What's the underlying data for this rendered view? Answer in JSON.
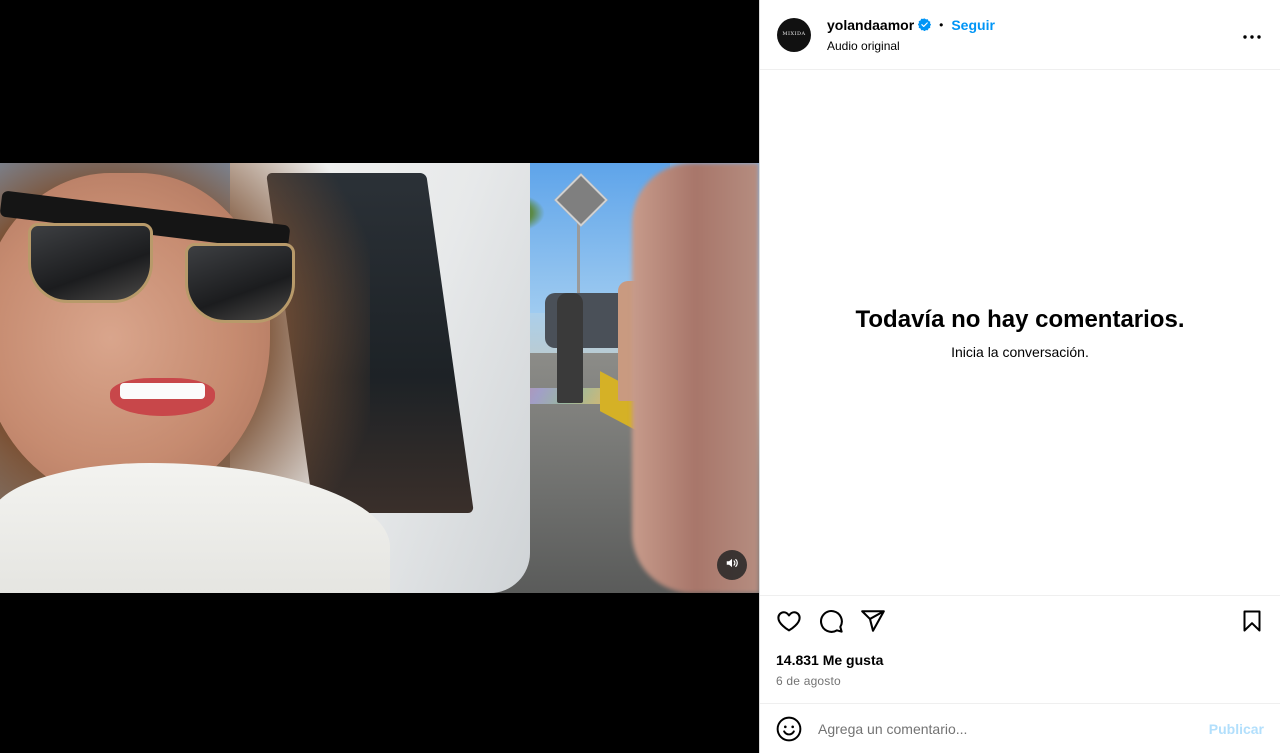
{
  "header": {
    "avatar_text": "MIXIDA",
    "username": "yolandaamor",
    "separator": "•",
    "follow_label": "Seguir",
    "audio_label": "Audio original"
  },
  "comments": {
    "empty_title": "Todavía no hay comentarios.",
    "empty_subtitle": "Inicia la conversación."
  },
  "actions": {
    "likes_text": "14.831 Me gusta",
    "date_text": "6 de agosto"
  },
  "comment_box": {
    "placeholder": "Agrega un comentario...",
    "publish_label": "Publicar"
  },
  "icons": {
    "avatar": "avatar-icon",
    "verified": "verified-badge-icon",
    "more": "more-options-icon",
    "mute": "speaker-icon",
    "like": "heart-icon",
    "comment": "comment-bubble-icon",
    "share": "paper-plane-icon",
    "save": "bookmark-icon",
    "emoji": "emoji-smile-icon"
  },
  "colors": {
    "accent": "#0095f6",
    "publish_disabled": "#b2dffc",
    "secondary_text": "#737373",
    "media_background": "#000000"
  }
}
